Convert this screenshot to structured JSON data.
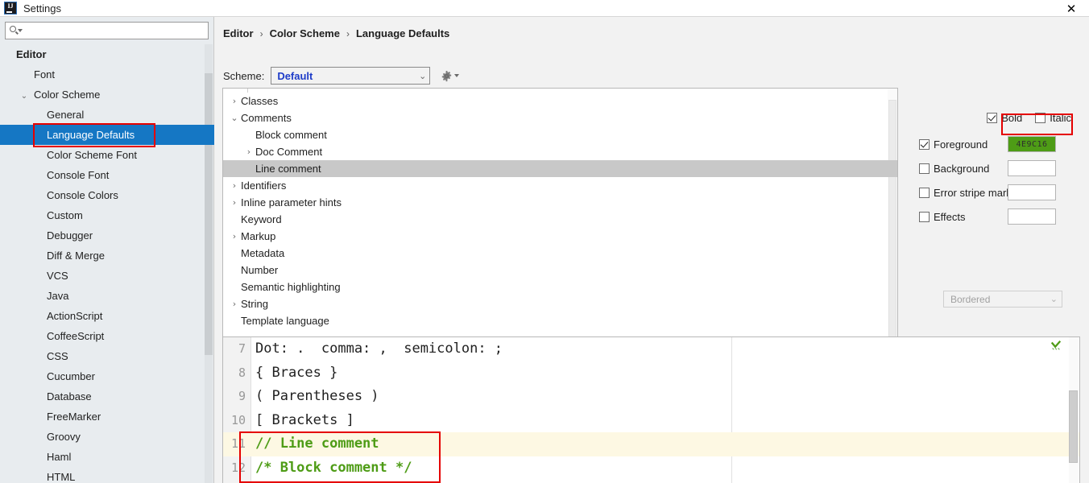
{
  "window": {
    "title": "Settings",
    "app_icon": "intellij-idea-logo",
    "close_label": "✕"
  },
  "search": {
    "value": "",
    "placeholder": "",
    "icon": "search-icon"
  },
  "sidebar": {
    "items": [
      {
        "label": "Editor",
        "level": 0,
        "twisty": "",
        "selected": false
      },
      {
        "label": "Font",
        "level": 1,
        "twisty": "",
        "selected": false
      },
      {
        "label": "Color Scheme",
        "level": 1,
        "twisty": "⌄",
        "selected": false
      },
      {
        "label": "General",
        "level": 2,
        "twisty": "",
        "selected": false
      },
      {
        "label": "Language Defaults",
        "level": 2,
        "twisty": "",
        "selected": true
      },
      {
        "label": "Color Scheme Font",
        "level": 2,
        "twisty": "",
        "selected": false
      },
      {
        "label": "Console Font",
        "level": 2,
        "twisty": "",
        "selected": false
      },
      {
        "label": "Console Colors",
        "level": 2,
        "twisty": "",
        "selected": false
      },
      {
        "label": "Custom",
        "level": 2,
        "twisty": "",
        "selected": false
      },
      {
        "label": "Debugger",
        "level": 2,
        "twisty": "",
        "selected": false
      },
      {
        "label": "Diff & Merge",
        "level": 2,
        "twisty": "",
        "selected": false
      },
      {
        "label": "VCS",
        "level": 2,
        "twisty": "",
        "selected": false
      },
      {
        "label": "Java",
        "level": 2,
        "twisty": "",
        "selected": false
      },
      {
        "label": "ActionScript",
        "level": 2,
        "twisty": "",
        "selected": false
      },
      {
        "label": "CoffeeScript",
        "level": 2,
        "twisty": "",
        "selected": false
      },
      {
        "label": "CSS",
        "level": 2,
        "twisty": "",
        "selected": false
      },
      {
        "label": "Cucumber",
        "level": 2,
        "twisty": "",
        "selected": false
      },
      {
        "label": "Database",
        "level": 2,
        "twisty": "",
        "selected": false
      },
      {
        "label": "FreeMarker",
        "level": 2,
        "twisty": "",
        "selected": false
      },
      {
        "label": "Groovy",
        "level": 2,
        "twisty": "",
        "selected": false
      },
      {
        "label": "Haml",
        "level": 2,
        "twisty": "",
        "selected": false
      },
      {
        "label": "HTML",
        "level": 2,
        "twisty": "",
        "selected": false
      }
    ]
  },
  "breadcrumb": {
    "parts": [
      "Editor",
      "Color Scheme",
      "Language Defaults"
    ],
    "separator": "›"
  },
  "scheme": {
    "label": "Scheme:",
    "value": "Default",
    "chevron": "⌄",
    "gear_icon": "gear-icon"
  },
  "attribute_tree": {
    "rows": [
      {
        "label": "Classes",
        "indent": 0,
        "twisty": "›",
        "selected": false
      },
      {
        "label": "Comments",
        "indent": 0,
        "twisty": "⌄",
        "selected": false
      },
      {
        "label": "Block comment",
        "indent": 1,
        "twisty": "",
        "selected": false
      },
      {
        "label": "Doc Comment",
        "indent": 1,
        "twisty": "›",
        "selected": false
      },
      {
        "label": "Line comment",
        "indent": 1,
        "twisty": "",
        "selected": true
      },
      {
        "label": "Identifiers",
        "indent": 0,
        "twisty": "›",
        "selected": false
      },
      {
        "label": "Inline parameter hints",
        "indent": 0,
        "twisty": "›",
        "selected": false
      },
      {
        "label": "Keyword",
        "indent": 0,
        "twisty": "",
        "selected": false
      },
      {
        "label": "Markup",
        "indent": 0,
        "twisty": "›",
        "selected": false
      },
      {
        "label": "Metadata",
        "indent": 0,
        "twisty": "",
        "selected": false
      },
      {
        "label": "Number",
        "indent": 0,
        "twisty": "",
        "selected": false
      },
      {
        "label": "Semantic highlighting",
        "indent": 0,
        "twisty": "",
        "selected": false
      },
      {
        "label": "String",
        "indent": 0,
        "twisty": "›",
        "selected": false
      },
      {
        "label": "Template language",
        "indent": 0,
        "twisty": "",
        "selected": false
      }
    ]
  },
  "attributes": {
    "bold": {
      "label": "Bold",
      "checked": true
    },
    "italic": {
      "label": "Italic",
      "checked": false
    },
    "foreground": {
      "label": "Foreground",
      "checked": true,
      "color": "#4E9C16",
      "hex_text": "4E9C16"
    },
    "background": {
      "label": "Background",
      "checked": false,
      "color": ""
    },
    "error_stripe_mark": {
      "label": "Error stripe mark",
      "checked": false,
      "color": ""
    },
    "effects": {
      "label": "Effects",
      "checked": false,
      "color": ""
    },
    "effect_type": {
      "value": "Bordered",
      "chevron": "⌄",
      "disabled": true
    }
  },
  "preview": {
    "comment_color": "#4E9C16",
    "caret_line_color": "#FDF8E3",
    "inspection_icon": "inspection-check-icon",
    "lines": [
      {
        "number": "7",
        "text": "Dot: .  comma: ,  semicolon: ;",
        "comment": false,
        "caret": false
      },
      {
        "number": "8",
        "text": "{ Braces }",
        "comment": false,
        "caret": false
      },
      {
        "number": "9",
        "text": "( Parentheses )",
        "comment": false,
        "caret": false
      },
      {
        "number": "10",
        "text": "[ Brackets ]",
        "comment": false,
        "caret": false
      },
      {
        "number": "11",
        "text": "// Line comment",
        "comment": true,
        "caret": true
      },
      {
        "number": "12",
        "text": "/* Block comment */",
        "comment": true,
        "caret": false
      }
    ]
  },
  "annotations": {
    "color": "#E50000",
    "boxes": [
      "sidebar-language-defaults",
      "foreground-color-swatch",
      "preview-comment-lines"
    ]
  }
}
